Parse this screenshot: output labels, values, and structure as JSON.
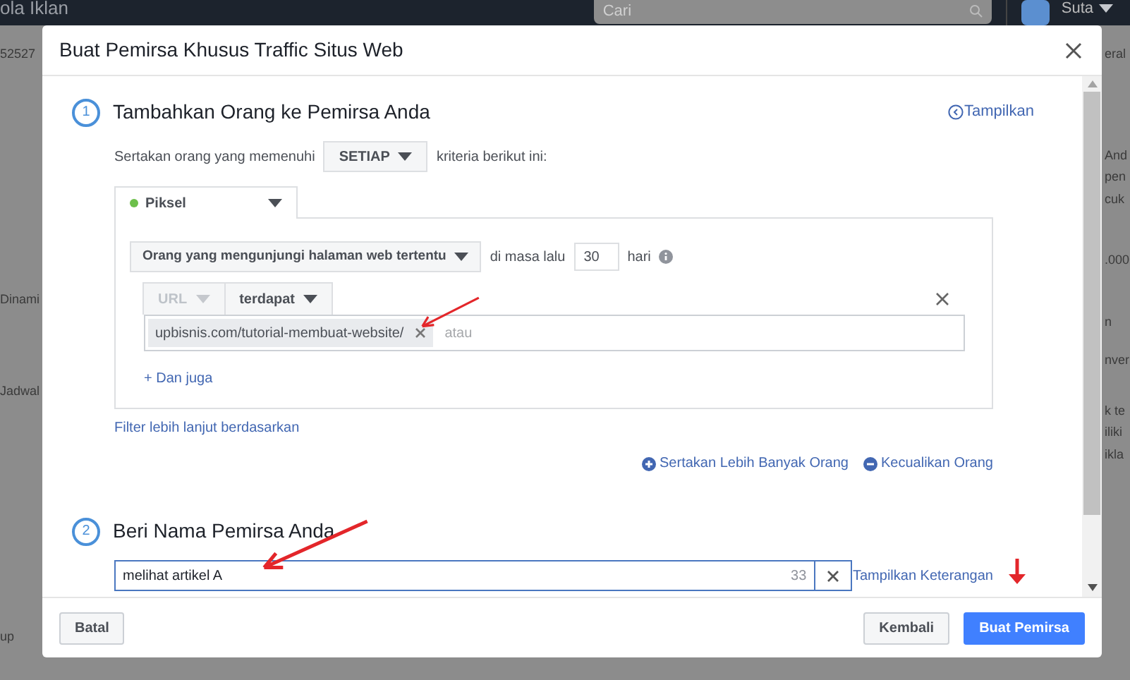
{
  "top_bar": {
    "title": "ola Iklan",
    "search": {
      "placeholder": "Cari"
    },
    "user": "Suta"
  },
  "background": {
    "left_texts": [
      "52527",
      "Dinami",
      "Jadwal",
      "up"
    ],
    "right_texts": [
      "eral",
      "And",
      "pen",
      "cuk",
      ".000",
      "n",
      "nver",
      "k te",
      "iliki",
      "ikla"
    ]
  },
  "dialog": {
    "title": "Buat Pemirsa Khusus Traffic Situs Web",
    "section_1": {
      "number": "1",
      "title": "Tambahkan Orang ke Pemirsa Anda",
      "toggle_link": "Tampilkan",
      "criteria": {
        "before": "Sertakan orang yang memenuhi",
        "dropdown": "SETIAP",
        "after": "kriteria berikut ini:"
      },
      "source_tab": {
        "label": "Piksel"
      },
      "rule": {
        "dropdown": "Orang yang mengunjungi halaman web tertentu",
        "before_days": "di masa lalu",
        "days": "30",
        "after_days": "hari",
        "url_dropdown": {
          "label": "URL",
          "disabled": true
        },
        "match_dropdown": {
          "label": "terdapat",
          "disabled": false
        },
        "tokens": [
          "upbisnis.com/tutorial-membuat-website/"
        ],
        "placeholder": "atau",
        "and_link": "+ Dan juga"
      },
      "filter_link": "Filter lebih lanjut berdasarkan",
      "include_link": "Sertakan Lebih Banyak Orang",
      "exclude_link": "Kecualikan Orang"
    },
    "section_2": {
      "number": "2",
      "title": "Beri Nama Pemirsa Anda",
      "name_value": "melihat artikel A",
      "remaining": "33",
      "description_link": "Tampilkan Keterangan"
    },
    "buttons": {
      "cancel": "Batal",
      "back": "Kembali",
      "create": "Buat Pemirsa"
    }
  }
}
